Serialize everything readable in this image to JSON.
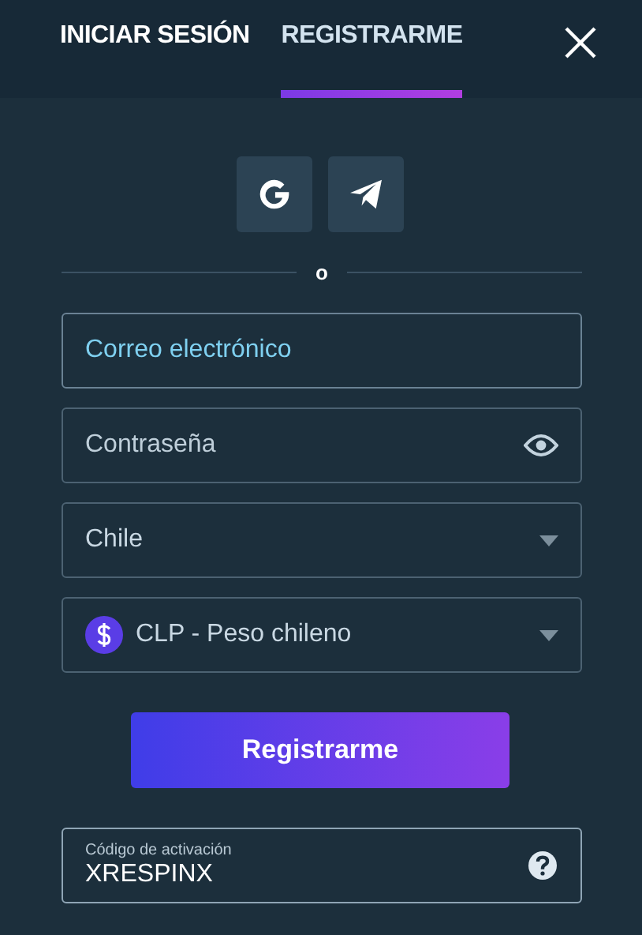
{
  "tabs": [
    {
      "label": "INICIAR SESIÓN",
      "selected": false
    },
    {
      "label": "REGISTRARME",
      "selected": true
    }
  ],
  "social_buttons": [
    {
      "kind": "google"
    },
    {
      "kind": "telegram"
    }
  ],
  "divider_text": "o",
  "fields": [
    {
      "kind": "text",
      "placeholder": "Correo electrónico",
      "focused": true
    },
    {
      "kind": "password",
      "placeholder": "Contraseña",
      "focused": false
    },
    {
      "kind": "select",
      "value": "Chile",
      "focused": false
    },
    {
      "kind": "currency",
      "value": "CLP - Peso chileno",
      "focused": false
    }
  ],
  "submit_button": "Registrarme",
  "activation_code": {
    "label": "Código de activación",
    "value": "XRESPINX"
  }
}
